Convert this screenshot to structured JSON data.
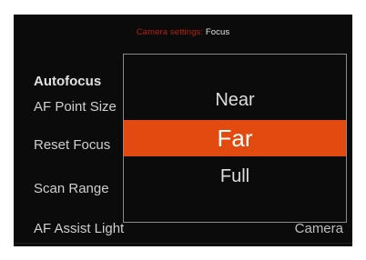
{
  "header": {
    "crumb": "Camera settings",
    "separator": ":",
    "current": "Focus"
  },
  "menu": {
    "section_title": "Autofocus",
    "items": [
      {
        "label": "AF Point Size",
        "value": ""
      },
      {
        "label": "Reset Focus",
        "value": ""
      },
      {
        "label": "Scan Range",
        "value": ""
      },
      {
        "label": "AF Assist Light",
        "value": "Camera"
      }
    ]
  },
  "popup": {
    "options": [
      "Near",
      "Far",
      "Full"
    ],
    "selected": "Far"
  },
  "colors": {
    "accent": "#e24a0f",
    "crumb": "#b6200c",
    "background": "#0b0b0b",
    "popup_border": "#8a8a8a"
  }
}
